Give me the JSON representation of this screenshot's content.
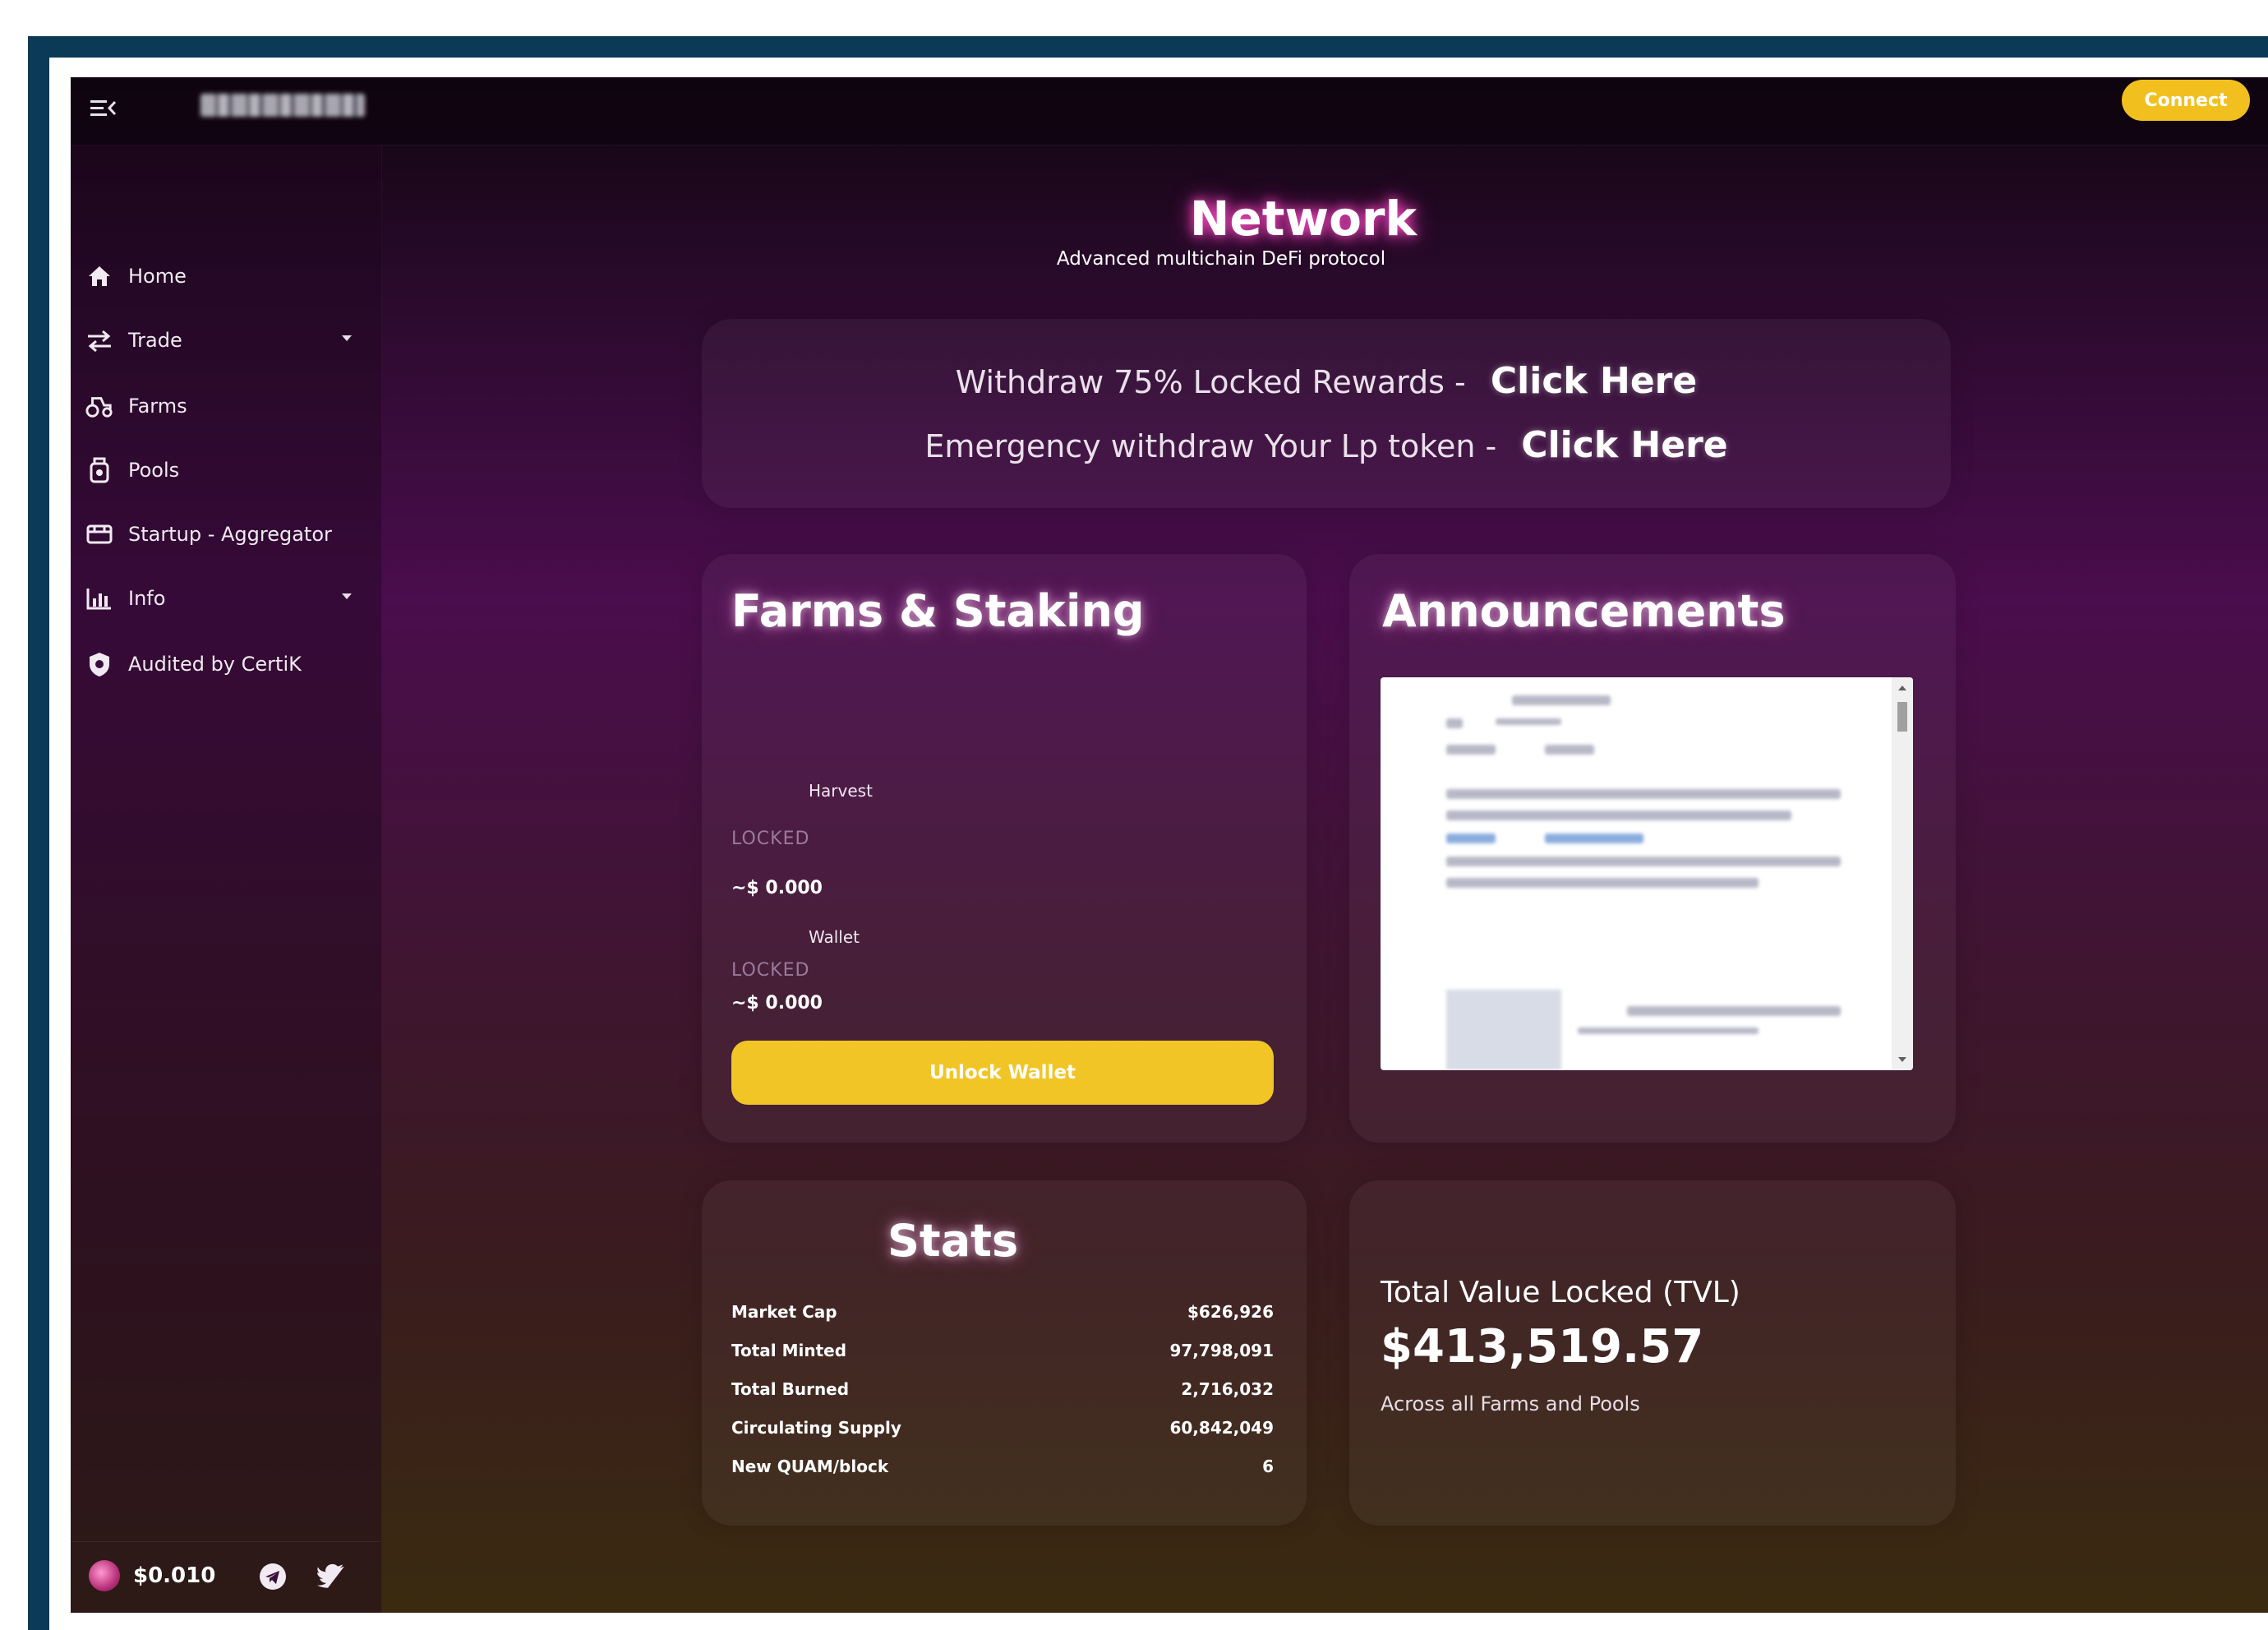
{
  "topbar": {
    "connect_label": "Connect"
  },
  "sidebar": {
    "items": [
      {
        "label": "Home",
        "icon": "home-icon"
      },
      {
        "label": "Trade",
        "icon": "swap-arrows-icon"
      },
      {
        "label": "Farms",
        "icon": "tractor-icon"
      },
      {
        "label": "Pools",
        "icon": "pool-jar-icon"
      },
      {
        "label": "Startup - Aggregator",
        "icon": "startup-icon"
      },
      {
        "label": "Info",
        "icon": "chart-icon"
      },
      {
        "label": "Audited by CertiK",
        "icon": "shield-icon"
      }
    ],
    "footer": {
      "token_price": "$0.010"
    }
  },
  "hero": {
    "title": "Network",
    "subtitle": "Advanced multichain DeFi protocol"
  },
  "withdraw": {
    "line1_text": "Withdraw 75% Locked Rewards -",
    "line1_link": "Click Here",
    "line2_text": "Emergency withdraw Your Lp token -",
    "line2_link": "Click Here"
  },
  "farms": {
    "title": "Farms & Staking",
    "harvest_label": "Harvest",
    "harvest_locked": "LOCKED",
    "harvest_value": "~$ 0.000",
    "wallet_label": "Wallet",
    "wallet_locked": "LOCKED",
    "wallet_value": "~$ 0.000",
    "unlock_label": "Unlock Wallet"
  },
  "announcements": {
    "title": "Announcements"
  },
  "stats": {
    "title": "Stats",
    "rows": [
      {
        "label": "Market Cap",
        "value": "$626,926"
      },
      {
        "label": "Total Minted",
        "value": "97,798,091"
      },
      {
        "label": "Total Burned",
        "value": "2,716,032"
      },
      {
        "label": "Circulating Supply",
        "value": "60,842,049"
      },
      {
        "label": "New QUAM/block",
        "value": "6"
      }
    ]
  },
  "tvl": {
    "title": "Total Value Locked (TVL)",
    "value": "$413,519.57",
    "caption": "Across all Farms and Pools"
  },
  "colors": {
    "accent_yellow": "#f2c01e",
    "background_purple": "#4a0d4d",
    "frame_blue": "#0b3a57",
    "glow_pink": "#ff4fc8"
  }
}
